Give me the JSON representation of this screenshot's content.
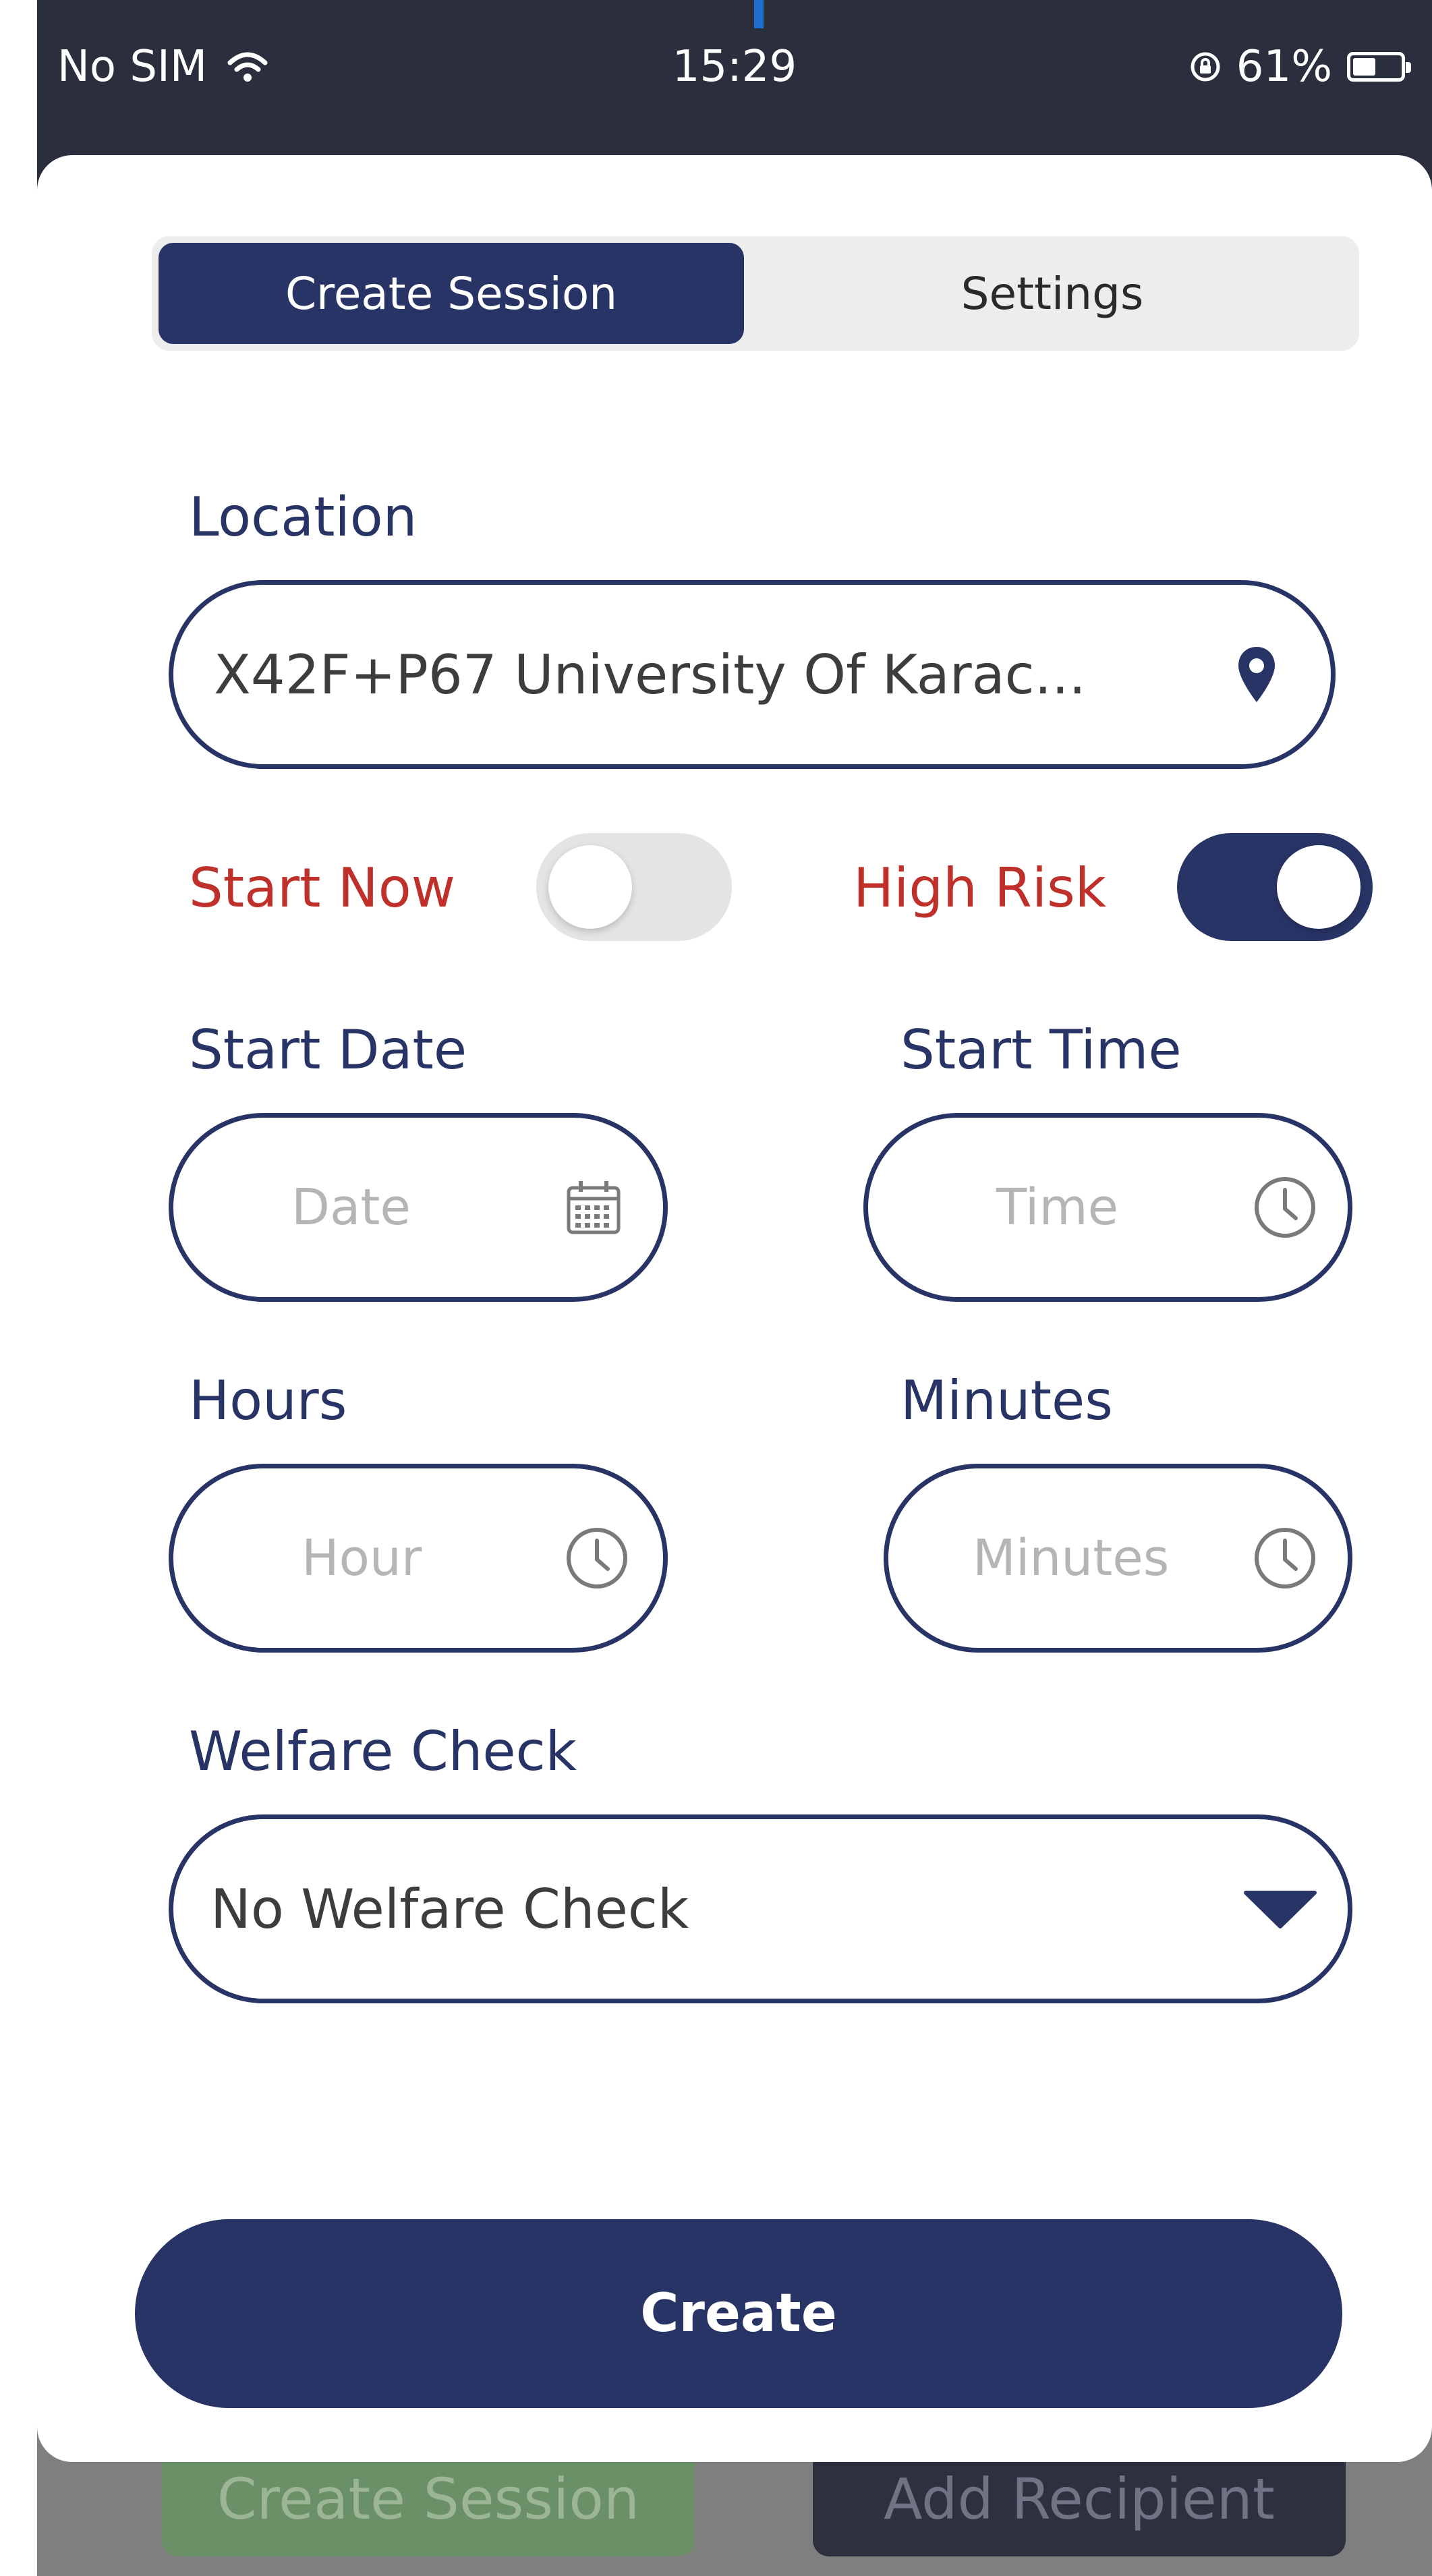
{
  "status_bar": {
    "carrier": "No SIM",
    "time": "15:29",
    "battery": "61%",
    "battery_level": 0.61
  },
  "background": {
    "create_session_button": "Create Session",
    "add_recipient_button": "Add Recipient"
  },
  "tabs": [
    {
      "label": "Create Session",
      "active": true
    },
    {
      "label": "Settings",
      "active": false
    }
  ],
  "form": {
    "location": {
      "label": "Location",
      "value": "X42F+P67 University Of Karac..."
    },
    "start_now": {
      "label": "Start Now",
      "on": false
    },
    "high_risk": {
      "label": "High Risk",
      "on": true
    },
    "start_date": {
      "label": "Start Date",
      "placeholder": "Date"
    },
    "start_time": {
      "label": "Start Time",
      "placeholder": "Time"
    },
    "hours": {
      "label": "Hours",
      "placeholder": "Hour"
    },
    "minutes": {
      "label": "Minutes",
      "placeholder": "Minutes"
    },
    "welfare_check": {
      "label": "Welfare Check",
      "value": "No Welfare Check"
    },
    "create_label": "Create"
  },
  "colors": {
    "primary": "#283466",
    "accent_red": "#c0302a"
  },
  "icons": [
    "wifi-icon",
    "lock-rotation-icon",
    "battery-icon",
    "location-pin-icon",
    "calendar-icon",
    "clock-icon",
    "dropdown-arrow-icon"
  ]
}
